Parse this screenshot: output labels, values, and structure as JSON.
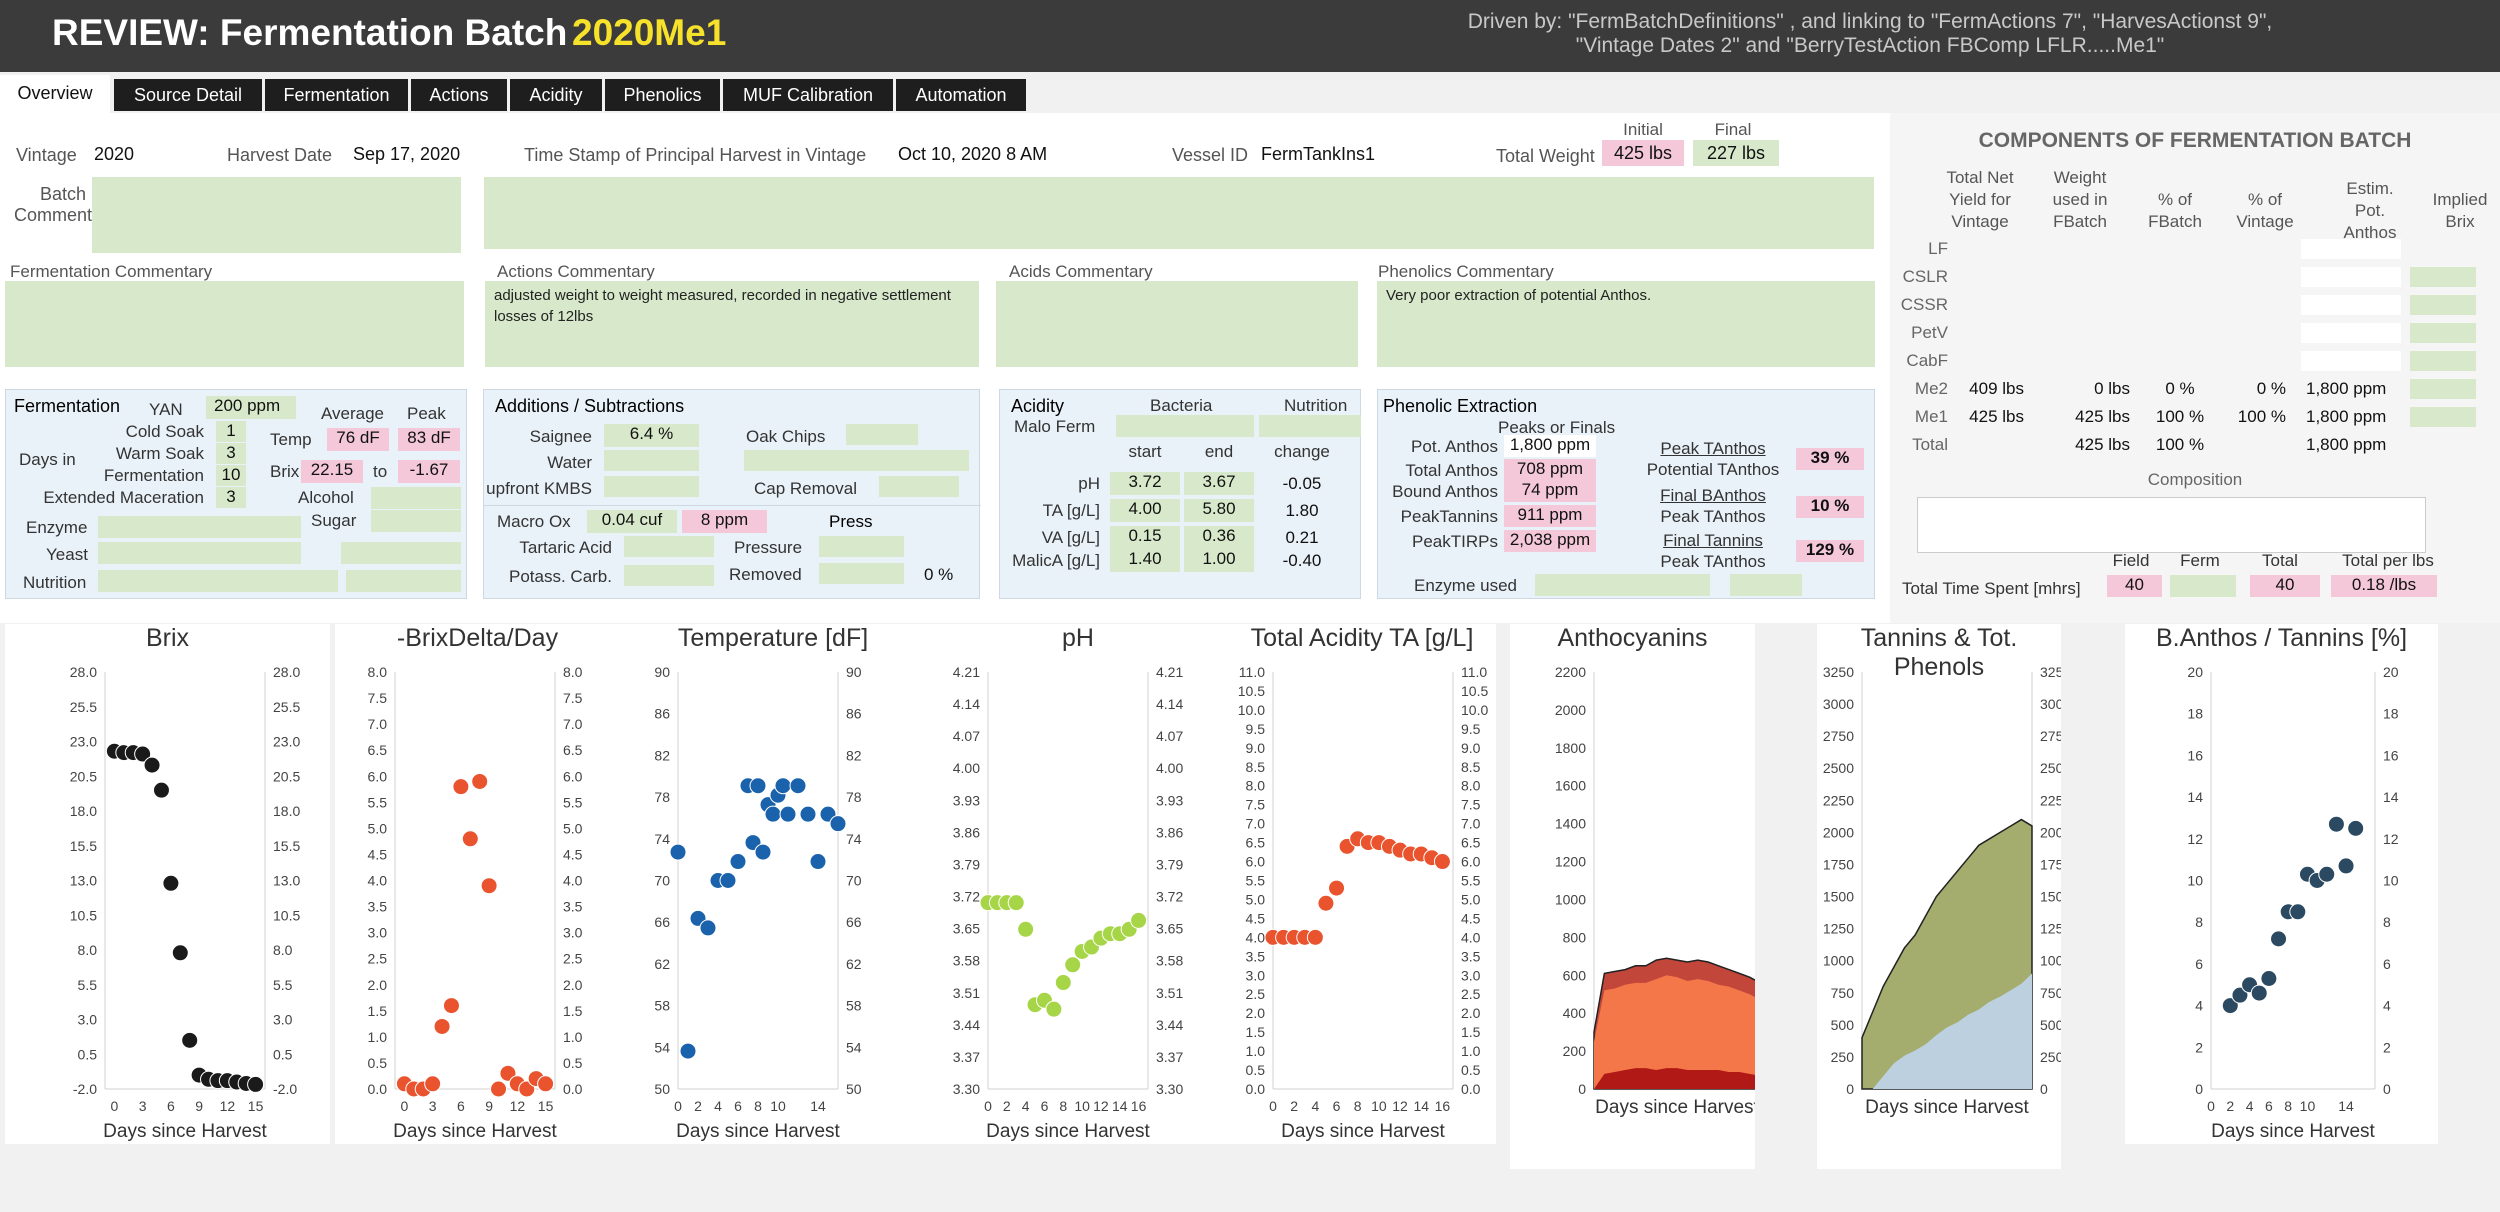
{
  "header": {
    "title_prefix": "REVIEW: Fermentation Batch ",
    "title_batch": "2020Me1",
    "driven_line1": "Driven by: \"FermBatchDefinitions\" , and linking to  \"FermActions 7\", \"HarvesActionst 9\",",
    "driven_line2": "\"Vintage Dates 2\" and \"BerryTestAction FBComp LFLR.....Me1\"",
    "batch_color": "#f7e22b"
  },
  "tabs": [
    "Overview",
    "Source Detail",
    "Fermentation",
    "Actions",
    "Acidity",
    "Phenolics",
    "MUF Calibration",
    "Automation"
  ],
  "info": {
    "vintage_label": "Vintage",
    "vintage": "2020",
    "harvest_label": "Harvest Date",
    "harvest": "Sep 17, 2020",
    "ts_label": "Time Stamp of Principal Harvest in Vintage",
    "ts": "Oct 10, 2020  8 AM",
    "vessel_label": "Vessel ID",
    "vessel": "FermTankIns1",
    "weight_label": "Total Weight",
    "initial_label": "Initial",
    "final_label": "Final",
    "initial": "425 lbs",
    "final": "227 lbs",
    "batch_comment": "Batch\nComment"
  },
  "commentary": {
    "ferm_label": "Fermentation Commentary",
    "actions_label": "Actions Commentary",
    "actions_text": "adjusted weight to weight measured, recorded in negative settlement losses of 12lbs",
    "acids_label": "Acids Commentary",
    "phen_label": "Phenolics Commentary",
    "phen_text": "Very poor extraction of potential Anthos."
  },
  "fermentation": {
    "title": "Fermentation",
    "yan_label": "YAN",
    "yan": "200 ppm",
    "days_in": "Days in",
    "cold_soak": "Cold Soak",
    "cold_soak_v": "1",
    "warm_soak": "Warm Soak",
    "warm_soak_v": "3",
    "fermentation": "Fermentation",
    "ferm_v": "10",
    "ext_mac": "Extended Maceration",
    "ext_mac_v": "3",
    "average": "Average",
    "peak": "Peak",
    "temp": "Temp",
    "temp_avg": "76 dF",
    "temp_peak": "83 dF",
    "brix": "Brix",
    "brix_from": "22.15",
    "to": "to",
    "brix_to": "-1.67",
    "alcohol": "Alcohol",
    "sugar": "Sugar",
    "enzyme": "Enzyme",
    "yeast": "Yeast",
    "nutrition": "Nutrition"
  },
  "additions": {
    "title": "Additions / Subtractions",
    "saignee": "Saignee",
    "saignee_v": "6.4 %",
    "water": "Water",
    "kmbs": "upfront KMBS",
    "oak": "Oak Chips",
    "cap": "Cap Removal",
    "macro": "Macro Ox",
    "macro_v1": "0.04 cuf",
    "macro_v2": "8 ppm",
    "press": "Press",
    "tartaric": "Tartaric Acid",
    "potass": "Potass. Carb.",
    "pressure": "Pressure",
    "removed": "Removed",
    "removed_v": "0 %"
  },
  "acidity": {
    "title": "Acidity",
    "bacteria": "Bacteria",
    "nutrition": "Nutrition",
    "malo": "Malo Ferm",
    "start": "start",
    "end": "end",
    "change": "change",
    "rows": [
      {
        "l": "pH",
        "s": "3.72",
        "e": "3.67",
        "c": "-0.05"
      },
      {
        "l": "TA [g/L]",
        "s": "4.00",
        "e": "5.80",
        "c": "1.80"
      },
      {
        "l": "VA [g/L]",
        "s": "0.15",
        "e": "0.36",
        "c": "0.21"
      },
      {
        "l": "MalicA [g/L]",
        "s": "1.40",
        "e": "1.00",
        "c": "-0.40"
      }
    ]
  },
  "phenolic": {
    "title": "Phenolic Extraction",
    "peaks": "Peaks  or Finals",
    "rows": [
      {
        "l": "Pot. Anthos",
        "v": "1,800 ppm"
      },
      {
        "l": "Total Anthos",
        "v": "708 ppm"
      },
      {
        "l": "Bound Anthos",
        "v": "74 ppm"
      },
      {
        "l": "PeakTannins",
        "v": "911 ppm"
      },
      {
        "l": "PeakTIRPs",
        "v": "2,038 ppm"
      }
    ],
    "r1a": "Peak TAnthos",
    "r1b": "Potential TAnthos",
    "r1v": "39 %",
    "r2a": "Final BAnthos",
    "r2b": "Peak TAnthos",
    "r2v": "10 %",
    "r3a": "Final Tannins",
    "r3b": "Peak TAnthos",
    "r3v": "129 %",
    "enzyme": "Enzyme used"
  },
  "components": {
    "title": "COMPONENTS OF FERMENTATION BATCH",
    "h1": "Total Net\nYield for\nVintage",
    "h2": "Weight\nused in\nFBatch",
    "h3": "% of\nFBatch",
    "h4": "% of\nVintage",
    "h5": "Estim.\nPot.\nAnthos",
    "h6": "Implied\nBrix",
    "rows": [
      {
        "n": "LF",
        "a": "",
        "b": "",
        "c": "",
        "d": "",
        "e": ""
      },
      {
        "n": "CSLR",
        "a": "",
        "b": "",
        "c": "",
        "d": "",
        "e": ""
      },
      {
        "n": "CSSR",
        "a": "",
        "b": "",
        "c": "",
        "d": "",
        "e": ""
      },
      {
        "n": "PetV",
        "a": "",
        "b": "",
        "c": "",
        "d": "",
        "e": ""
      },
      {
        "n": "CabF",
        "a": "",
        "b": "",
        "c": "",
        "d": "",
        "e": ""
      },
      {
        "n": "Me2",
        "a": "409 lbs",
        "b": "0 lbs",
        "c": "0 %",
        "d": "0 %",
        "e": "1,800 ppm"
      },
      {
        "n": "Me1",
        "a": "425 lbs",
        "b": "425 lbs",
        "c": "100 %",
        "d": "100 %",
        "e": "1,800 ppm"
      },
      {
        "n": "Total",
        "a": "",
        "b": "425 lbs",
        "c": "100 %",
        "d": "",
        "e": "1,800 ppm"
      }
    ],
    "composition": "Composition",
    "tts": "Total Time Spent [mhrs]",
    "field": "Field",
    "ferm": "Ferm",
    "total": "Total",
    "per_lbs": "Total per lbs",
    "field_v": "40",
    "total_v": "40",
    "per_lbs_v": "0.18 /lbs"
  },
  "chart_data": [
    {
      "type": "scatter",
      "title": "Brix",
      "xlabel": "Days since Harvest",
      "ylim": [
        -2,
        28
      ],
      "yticks": [
        "28.0",
        "25.5",
        "23.0",
        "20.5",
        "18.0",
        "15.5",
        "13.0",
        "10.5",
        "8.0",
        "5.5",
        "3.0",
        "0.5",
        "-2.0"
      ],
      "xticks": [
        "0",
        "3",
        "6",
        "9",
        "12",
        "15"
      ],
      "xlim": [
        -1,
        16
      ],
      "color": "#1a1a1a",
      "x": [
        0,
        1,
        2,
        3,
        4,
        5,
        6,
        7,
        8,
        9,
        10,
        11,
        12,
        13,
        14,
        15
      ],
      "y": [
        22.3,
        22.2,
        22.2,
        22.1,
        21.3,
        19.5,
        12.8,
        7.8,
        1.5,
        -1.0,
        -1.3,
        -1.4,
        -1.4,
        -1.5,
        -1.6,
        -1.67
      ]
    },
    {
      "type": "scatter",
      "title": "-BrixDelta/Day",
      "xlabel": "Days since Harvest",
      "ylim": [
        0,
        8
      ],
      "yticks": [
        "8.0",
        "7.5",
        "7.0",
        "6.5",
        "6.0",
        "5.5",
        "5.0",
        "4.5",
        "4.0",
        "3.5",
        "3.0",
        "2.5",
        "2.0",
        "1.5",
        "1.0",
        "0.5",
        "0.0"
      ],
      "xticks": [
        "0",
        "3",
        "6",
        "9",
        "12",
        "15"
      ],
      "xlim": [
        -1,
        16
      ],
      "color": "#e9532e",
      "x": [
        0,
        1,
        2,
        3,
        4,
        5,
        6,
        7,
        8,
        9,
        10,
        11,
        12,
        13,
        14,
        15
      ],
      "y": [
        0.1,
        0.0,
        0.0,
        0.1,
        1.2,
        1.6,
        5.8,
        4.8,
        5.9,
        3.9,
        0.0,
        0.3,
        0.1,
        0.0,
        0.2,
        0.1
      ]
    },
    {
      "type": "scatter",
      "title": "Temperature [dF]",
      "xlabel": "Days since Harvest",
      "ylim": [
        50,
        94
      ],
      "yticks": [
        "90",
        "86",
        "82",
        "78",
        "74",
        "70",
        "66",
        "62",
        "58",
        "54",
        "50"
      ],
      "xticks": [
        "0",
        "2",
        "4",
        "6",
        "8",
        "10",
        "14"
      ],
      "xlim": [
        0,
        16
      ],
      "color": "#1a62ab",
      "x": [
        0,
        1,
        2,
        3,
        4,
        5,
        6,
        7,
        7.5,
        8,
        8.5,
        9,
        9.5,
        10,
        10.5,
        11,
        12,
        13,
        14,
        15,
        16
      ],
      "y": [
        75,
        54,
        68,
        67,
        72,
        72,
        74,
        82,
        76,
        82,
        75,
        80,
        79,
        81,
        82,
        79,
        82,
        79,
        74,
        79,
        78
      ]
    },
    {
      "type": "scatter",
      "title": "pH",
      "xlabel": "Days since Harvest",
      "ylim": [
        3.3,
        4.24
      ],
      "yticks": [
        "4.21",
        "4.14",
        "4.07",
        "4.00",
        "3.93",
        "3.86",
        "3.79",
        "3.72",
        "3.65",
        "3.58",
        "3.51",
        "3.44",
        "3.37",
        "3.30"
      ],
      "xticks": [
        "0",
        "2",
        "4",
        "6",
        "8",
        "10",
        "12",
        "14",
        "16"
      ],
      "xlim": [
        0,
        17
      ],
      "color": "#a7d548",
      "x": [
        0,
        1,
        2,
        3,
        4,
        5,
        6,
        7,
        8,
        9,
        10,
        11,
        12,
        13,
        14,
        15,
        16
      ],
      "y": [
        3.72,
        3.72,
        3.72,
        3.72,
        3.66,
        3.49,
        3.5,
        3.48,
        3.54,
        3.58,
        3.61,
        3.62,
        3.64,
        3.65,
        3.65,
        3.66,
        3.68
      ]
    },
    {
      "type": "scatter",
      "title": "Total Acidity TA [g/L]",
      "xlabel": "Days since Harvest",
      "ylim": [
        0,
        11
      ],
      "yticks": [
        "11.0",
        "10.5",
        "10.0",
        "9.5",
        "9.0",
        "8.5",
        "8.0",
        "7.5",
        "7.0",
        "6.5",
        "6.0",
        "5.5",
        "5.0",
        "4.5",
        "4.0",
        "3.5",
        "3.0",
        "2.5",
        "2.0",
        "1.5",
        "1.0",
        "0.5",
        "0.0"
      ],
      "xticks": [
        "0",
        "2",
        "4",
        "6",
        "8",
        "10",
        "12",
        "14",
        "16"
      ],
      "xlim": [
        0,
        17
      ],
      "color": "#e9532e",
      "x": [
        0,
        1,
        2,
        3,
        4,
        5,
        6,
        7,
        8,
        9,
        10,
        11,
        12,
        13,
        14,
        15,
        16
      ],
      "y": [
        4.0,
        4.0,
        4.0,
        4.0,
        4.0,
        4.9,
        5.3,
        6.4,
        6.6,
        6.5,
        6.5,
        6.4,
        6.3,
        6.2,
        6.2,
        6.1,
        6.0
      ]
    },
    {
      "type": "area",
      "title": "Anthocyanins",
      "xlabel": "Days since Harvest",
      "ylim": [
        0,
        2200
      ],
      "yticks": [
        "2200",
        "2000",
        "1800",
        "1600",
        "1400",
        "1200",
        "1000",
        "800",
        "600",
        "400",
        "200",
        "0"
      ],
      "x": [
        0,
        1,
        2,
        3,
        4,
        5,
        6,
        7,
        8,
        9,
        10,
        11,
        12,
        13,
        14,
        15,
        16
      ],
      "series": [
        {
          "values": [
            0,
            80,
            90,
            100,
            110,
            110,
            100,
            110,
            110,
            100,
            100,
            100,
            100,
            90,
            90,
            80,
            70
          ],
          "color": "#b11916"
        },
        {
          "values": [
            250,
            520,
            530,
            550,
            560,
            560,
            580,
            600,
            590,
            570,
            580,
            570,
            550,
            540,
            520,
            500,
            470
          ],
          "color": "#f4774a"
        },
        {
          "values": [
            300,
            610,
            620,
            630,
            650,
            650,
            680,
            690,
            680,
            670,
            680,
            670,
            650,
            630,
            610,
            590,
            560
          ],
          "color": "#c2463a"
        }
      ]
    },
    {
      "type": "area",
      "title": "Tannins & Tot. Phenols",
      "xlabel": "Days since Harvest",
      "ylim": [
        0,
        3250
      ],
      "yticks": [
        "3250",
        "3000",
        "2750",
        "2500",
        "2250",
        "2000",
        "1750",
        "1500",
        "1250",
        "1000",
        "750",
        "500",
        "250",
        "0"
      ],
      "x": [
        0,
        1,
        2,
        3,
        4,
        5,
        6,
        7,
        8,
        9,
        10,
        11,
        12,
        13,
        14,
        15,
        16
      ],
      "series": [
        {
          "values": [
            0,
            0,
            100,
            200,
            260,
            300,
            350,
            420,
            480,
            520,
            580,
            620,
            680,
            720,
            770,
            820,
            900
          ],
          "color": "#bcd0e0"
        },
        {
          "values": [
            400,
            600,
            800,
            950,
            1100,
            1200,
            1350,
            1500,
            1600,
            1700,
            1800,
            1900,
            1950,
            2000,
            2050,
            2100,
            2050
          ],
          "color": "#a4ad6d"
        }
      ]
    },
    {
      "type": "scatter",
      "title": "B.Anthos / Tannins [%]",
      "xlabel": "Days since Harvest",
      "ylim": [
        0,
        20
      ],
      "yticks": [
        "20",
        "18",
        "16",
        "14",
        "12",
        "10",
        "8",
        "6",
        "4",
        "2",
        "0"
      ],
      "xticks": [
        "0",
        "2",
        "4",
        "6",
        "8",
        "10",
        "14"
      ],
      "xlim": [
        0,
        17
      ],
      "color": "#2b4a62",
      "x": [
        2,
        3,
        4,
        5,
        6,
        7,
        8,
        9,
        10,
        11,
        12,
        13,
        14,
        15
      ],
      "y": [
        4,
        4.5,
        5,
        4.6,
        5.3,
        7.2,
        8.5,
        8.5,
        10.3,
        10,
        10.3,
        12.7,
        10.7,
        12.5
      ]
    }
  ]
}
